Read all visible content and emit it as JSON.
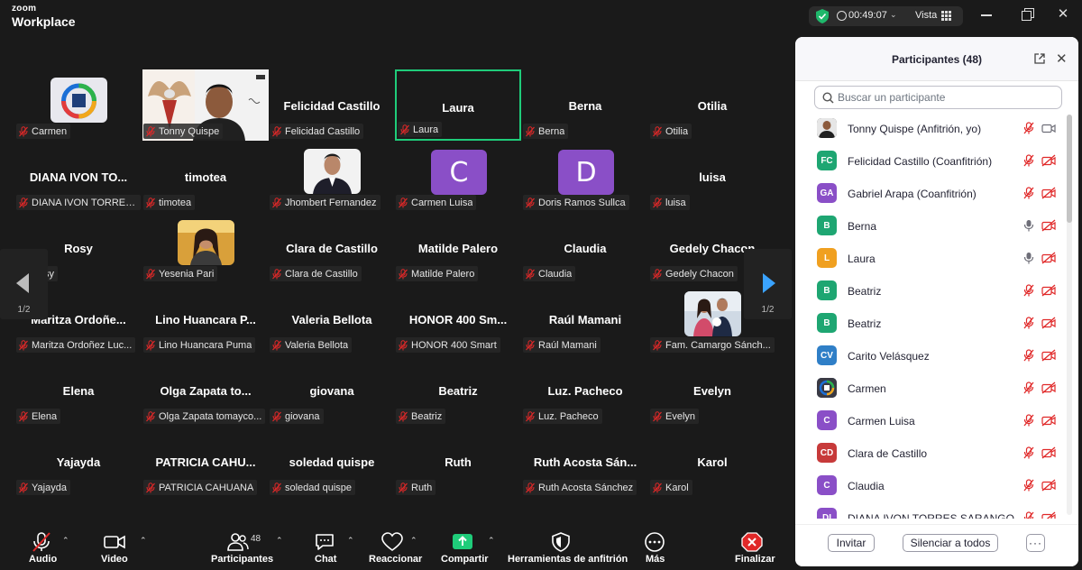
{
  "app": {
    "brand_top": "zoom",
    "brand_bottom": "Workplace"
  },
  "titlebar": {
    "timer": "00:49:07",
    "view_label": "Vista"
  },
  "gallery": {
    "tiles": [
      {
        "name": "",
        "label": "Carmen",
        "kind": "logo"
      },
      {
        "name": "",
        "label": "Tonny Quispe",
        "kind": "video"
      },
      {
        "name": "Felicidad Castillo",
        "label": "Felicidad Castillo",
        "kind": "name"
      },
      {
        "name": "Laura",
        "label": "Laura",
        "kind": "name",
        "active": true
      },
      {
        "name": "Berna",
        "label": "Berna",
        "kind": "name",
        "unmuted": true
      },
      {
        "name": "Otilia",
        "label": "Otilia",
        "kind": "name"
      },
      {
        "name": "DIANA IVON TO...",
        "label": "DIANA IVON TORRES...",
        "kind": "name"
      },
      {
        "name": "timotea",
        "label": "timotea",
        "kind": "name"
      },
      {
        "name": "",
        "label": "Jhombert Fernandez",
        "kind": "photo-man"
      },
      {
        "name": "",
        "label": "Carmen Luisa",
        "kind": "letter",
        "letter": "C"
      },
      {
        "name": "",
        "label": "Doris Ramos Sullca",
        "kind": "letter",
        "letter": "D"
      },
      {
        "name": "luisa",
        "label": "luisa",
        "kind": "name"
      },
      {
        "name": "Rosy",
        "label": "Rosy",
        "kind": "name"
      },
      {
        "name": "",
        "label": "Yesenia Pari",
        "kind": "photo-woman"
      },
      {
        "name": "Clara de Castillo",
        "label": "Clara de Castillo",
        "kind": "name"
      },
      {
        "name": "Matilde Palero",
        "label": "Matilde Palero",
        "kind": "name"
      },
      {
        "name": "Claudia",
        "label": "Claudia",
        "kind": "name"
      },
      {
        "name": "Gedely Chacon",
        "label": "Gedely Chacon",
        "kind": "name"
      },
      {
        "name": "Maritza  Ordoñe...",
        "label": "Maritza Ordoñez Luc...",
        "kind": "name"
      },
      {
        "name": "Lino  Huancara  P...",
        "label": "Lino Huancara Puma",
        "kind": "name"
      },
      {
        "name": "Valeria Bellota",
        "label": "Valeria Bellota",
        "kind": "name"
      },
      {
        "name": "HONOR 400 Sm...",
        "label": "HONOR 400 Smart",
        "kind": "name"
      },
      {
        "name": "Raúl Mamani",
        "label": "Raúl Mamani",
        "kind": "name"
      },
      {
        "name": "",
        "label": "Fam. Camargo Sánch...",
        "kind": "photo-family"
      },
      {
        "name": "Elena",
        "label": "Elena",
        "kind": "name"
      },
      {
        "name": "Olga  Zapata  to...",
        "label": "Olga Zapata tomayco...",
        "kind": "name"
      },
      {
        "name": "giovana",
        "label": "giovana",
        "kind": "name"
      },
      {
        "name": "Beatriz",
        "label": "Beatriz",
        "kind": "name"
      },
      {
        "name": "Luz. Pacheco",
        "label": "Luz. Pacheco",
        "kind": "name"
      },
      {
        "name": "Evelyn",
        "label": "Evelyn",
        "kind": "name"
      },
      {
        "name": "Yajayda",
        "label": "Yajayda",
        "kind": "name"
      },
      {
        "name": "PATRICIA  CAHU...",
        "label": "PATRICIA CAHUANA",
        "kind": "name"
      },
      {
        "name": "soledad quispe",
        "label": "soledad quispe",
        "kind": "name"
      },
      {
        "name": "Ruth",
        "label": "Ruth",
        "kind": "name"
      },
      {
        "name": "Ruth  Acosta  Sán...",
        "label": "Ruth Acosta Sánchez",
        "kind": "name"
      },
      {
        "name": "Karol",
        "label": "Karol",
        "kind": "name"
      }
    ],
    "page_left": "1/2",
    "page_right": "1/2"
  },
  "panel": {
    "title": "Participantes (48)",
    "search_placeholder": "Buscar un participante",
    "participants": [
      {
        "initials": "",
        "name": "Tonny Quispe (Anfitrión, yo)",
        "color": "#3a3a3a",
        "photo": true,
        "mic": "muted",
        "cam": "on"
      },
      {
        "initials": "FC",
        "name": "Felicidad Castillo (Coanfitrión)",
        "color": "#1ea672",
        "mic": "muted",
        "cam": "off"
      },
      {
        "initials": "GA",
        "name": "Gabriel Arapa (Coanfitrión)",
        "color": "#8a4fc7",
        "mic": "muted",
        "cam": "off"
      },
      {
        "initials": "B",
        "name": "Berna",
        "color": "#1ea672",
        "mic": "on",
        "cam": "off"
      },
      {
        "initials": "L",
        "name": "Laura",
        "color": "#f0a020",
        "mic": "on",
        "cam": "off"
      },
      {
        "initials": "B",
        "name": "Beatriz",
        "color": "#1ea672",
        "mic": "muted",
        "cam": "off"
      },
      {
        "initials": "B",
        "name": "Beatriz",
        "color": "#1ea672",
        "mic": "muted",
        "cam": "off"
      },
      {
        "initials": "CV",
        "name": "Carito Velásquez",
        "color": "#2f7fc7",
        "mic": "muted",
        "cam": "off"
      },
      {
        "initials": "",
        "name": "Carmen",
        "color": "#2a4a70",
        "logo": true,
        "mic": "muted",
        "cam": "off"
      },
      {
        "initials": "C",
        "name": "Carmen Luisa",
        "color": "#8a4fc7",
        "mic": "muted",
        "cam": "off"
      },
      {
        "initials": "CD",
        "name": "Clara de Castillo",
        "color": "#c73a3a",
        "mic": "muted",
        "cam": "off"
      },
      {
        "initials": "C",
        "name": "Claudia",
        "color": "#8a4fc7",
        "mic": "muted",
        "cam": "off"
      },
      {
        "initials": "DI",
        "name": "DIANA IVON TORRES SARANGO",
        "color": "#8a4fc7",
        "mic": "muted",
        "cam": "off"
      }
    ],
    "buttons": {
      "invite": "Invitar",
      "mute_all": "Silenciar a todos",
      "more": "···"
    }
  },
  "toolbar": {
    "audio": "Audio",
    "video": "Video",
    "participants": "Participantes",
    "participants_count": "48",
    "chat": "Chat",
    "react": "Reaccionar",
    "share": "Compartir",
    "host_tools": "Herramientas de anfitrión",
    "more": "Más",
    "end": "Finalizar"
  },
  "colors": {
    "accent_green": "#1fcc7a",
    "end_red": "#e02828",
    "muted_red": "#e02828"
  }
}
